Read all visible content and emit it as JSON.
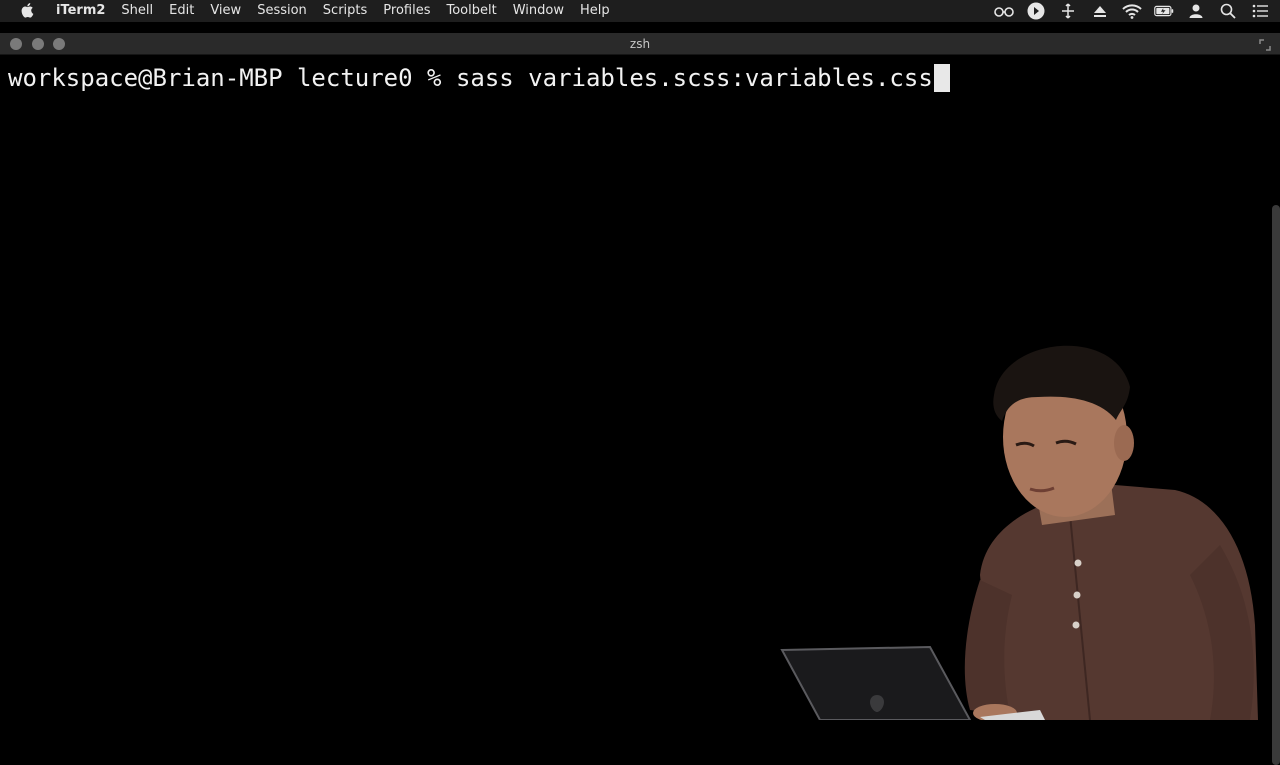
{
  "menubar": {
    "app_name": "iTerm2",
    "items": [
      "Shell",
      "Edit",
      "View",
      "Session",
      "Scripts",
      "Profiles",
      "Toolbelt",
      "Window",
      "Help"
    ]
  },
  "window": {
    "title": "zsh"
  },
  "terminal": {
    "prompt": "workspace@Brian-MBP lecture0 % ",
    "command": "sass variables.scss:variables.css"
  },
  "status_icons": [
    "glasses-icon",
    "play-circle-icon",
    "move-icon",
    "eject-icon",
    "wifi-icon",
    "battery-icon",
    "user-icon",
    "search-icon",
    "notification-center-icon"
  ],
  "colors": {
    "terminal_bg": "#000000",
    "terminal_fg": "#f2f2f2",
    "menubar_bg": "#1e1e1e",
    "shirt": "#5a3a30"
  }
}
